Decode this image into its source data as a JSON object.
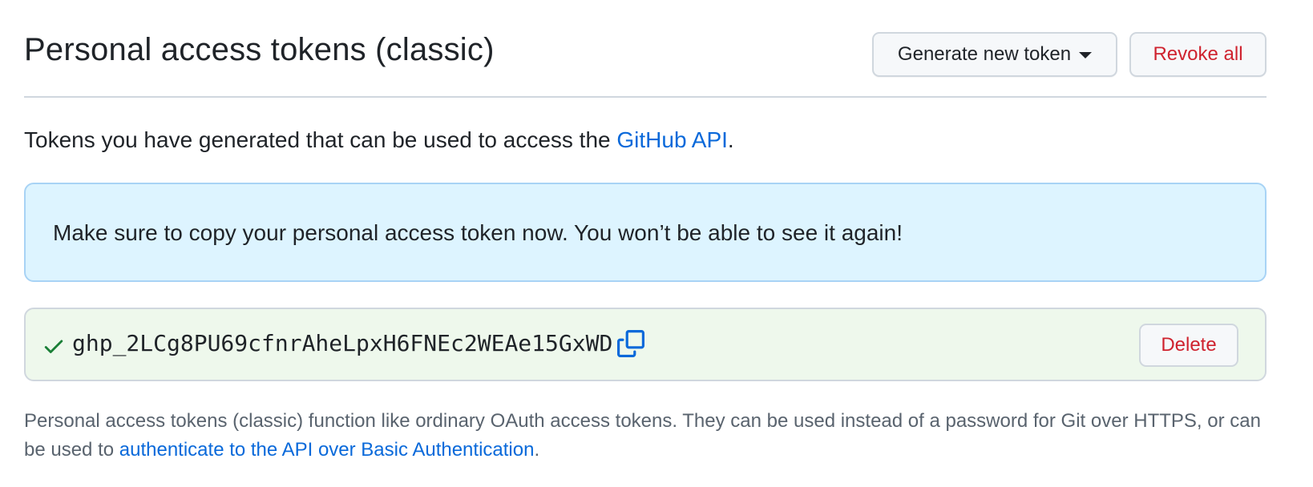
{
  "header": {
    "title": "Personal access tokens (classic)",
    "generate_label": "Generate new token",
    "revoke_label": "Revoke all"
  },
  "intro": {
    "text_before": "Tokens you have generated that can be used to access the ",
    "link_text": "GitHub API",
    "text_after": "."
  },
  "flash": {
    "message": "Make sure to copy your personal access token now. You won’t be able to see it again!"
  },
  "token": {
    "value": "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",
    "delete_label": "Delete",
    "status_icon": "check-icon",
    "copy_icon": "copy-icon"
  },
  "footer": {
    "text_before": "Personal access tokens (classic) function like ordinary OAuth access tokens. They can be used instead of a password for Git over HTTPS, or can be used to ",
    "link_text": "authenticate to the API over Basic Authentication",
    "text_after": "."
  },
  "colors": {
    "link": "#0969da",
    "danger": "#cf222e",
    "success": "#1a7f37",
    "flash_bg": "#ddf4ff",
    "token_bg": "#eef8ec"
  }
}
